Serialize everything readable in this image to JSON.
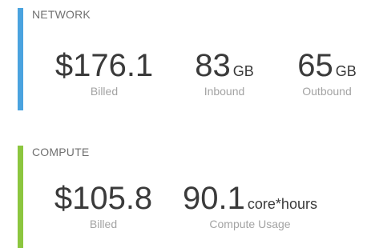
{
  "colors": {
    "network_accent": "#4aa3df",
    "compute_accent": "#8cc63f"
  },
  "network": {
    "title": "NETWORK",
    "metrics": [
      {
        "value": "$176.1",
        "unit": "",
        "caption": "Billed"
      },
      {
        "value": "83",
        "unit": "GB",
        "caption": "Inbound"
      },
      {
        "value": "65",
        "unit": "GB",
        "caption": "Outbound"
      }
    ]
  },
  "compute": {
    "title": "COMPUTE",
    "metrics": [
      {
        "value": "$105.8",
        "unit": "",
        "caption": "Billed"
      },
      {
        "value": "90.1",
        "unit": "core*hours",
        "caption": "Compute Usage"
      }
    ]
  }
}
